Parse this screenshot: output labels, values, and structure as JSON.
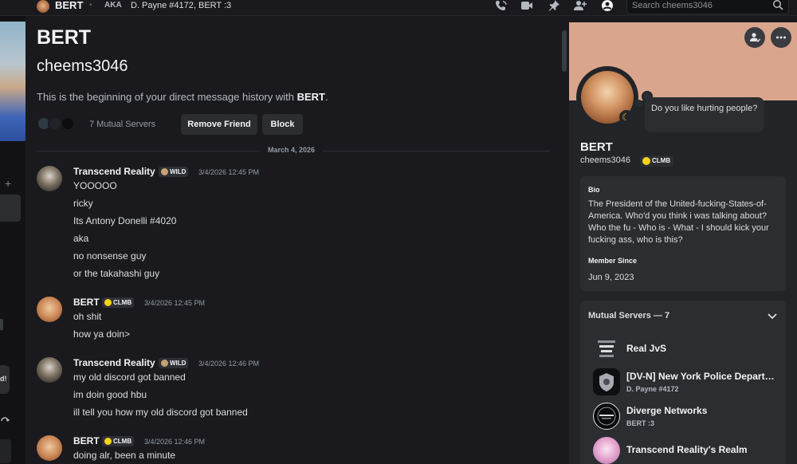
{
  "header": {
    "title": "BERT",
    "aka_label": "AKA",
    "aka_value": "D. Payne #4172, BERT :3",
    "search_placeholder": "Search cheems3046"
  },
  "intro": {
    "display_name": "BERT",
    "username": "cheems3046",
    "beginning_prefix": "This is the beginning of your direct message history with ",
    "beginning_name": "BERT",
    "beginning_suffix": ".",
    "mutual_servers": "7 Mutual Servers",
    "remove_friend_label": "Remove Friend",
    "block_label": "Block"
  },
  "date_divider": "March 4, 2026",
  "messages": [
    {
      "author": "Transcend Reality",
      "tag": "WILD",
      "time": "3/4/2026 12:45 PM",
      "lines": [
        "YOOOOO",
        "ricky",
        "Its Antony Donelli #4020",
        "aka",
        "no nonsense guy",
        "or the takahashi guy"
      ]
    },
    {
      "author": "BERT",
      "tag": "CLMB",
      "time": "3/4/2026 12:45 PM",
      "lines": [
        "oh shit",
        "how ya doin>"
      ]
    },
    {
      "author": "Transcend Reality",
      "tag": "WILD",
      "time": "3/4/2026 12:46 PM",
      "lines": [
        "my old discord got banned",
        "im doin good hbu",
        "ill tell you how my old discord got banned"
      ]
    },
    {
      "author": "BERT",
      "tag": "CLMB",
      "time": "3/4/2026 12:46 PM",
      "lines": [
        "doing alr, been a minute"
      ]
    }
  ],
  "profile": {
    "display_name": "BERT",
    "username": "cheems3046",
    "tag": "CLMB",
    "status_bubble": "Do you like hurting people?",
    "bio_label": "Bio",
    "bio": "The President of the United-fucking-States-of-America. Who'd you think i was talking about? Who the fu - Who is - What - I should kick your fucking ass, who is this?",
    "member_since_label": "Member Since",
    "member_since": "Jun 9, 2023",
    "mutual_servers_label": "Mutual Servers — 7",
    "servers": [
      {
        "name": "Real JvS",
        "nick": ""
      },
      {
        "name": "[DV-N] New York Police Department",
        "nick": "D. Payne #4172"
      },
      {
        "name": "Diverge Networks",
        "nick": "BERT :3"
      },
      {
        "name": "Transcend Reality's Realm",
        "nick": ""
      }
    ]
  },
  "left_sliver": {
    "plus": "+",
    "d_text": "d!"
  },
  "colors": {
    "background": "#1a1a1e",
    "panel": "#232428",
    "banner": "#d9a58d",
    "clmb_badge": "#f5d31b",
    "wild_badge": "#c8a16e",
    "idle_status": "#f0b232"
  },
  "icons": [
    "phone-call-icon",
    "video-call-icon",
    "pin-icon",
    "add-friend-icon",
    "user-profile-icon",
    "search-icon",
    "more-icon",
    "chevron-down-icon",
    "moon-status-icon"
  ]
}
